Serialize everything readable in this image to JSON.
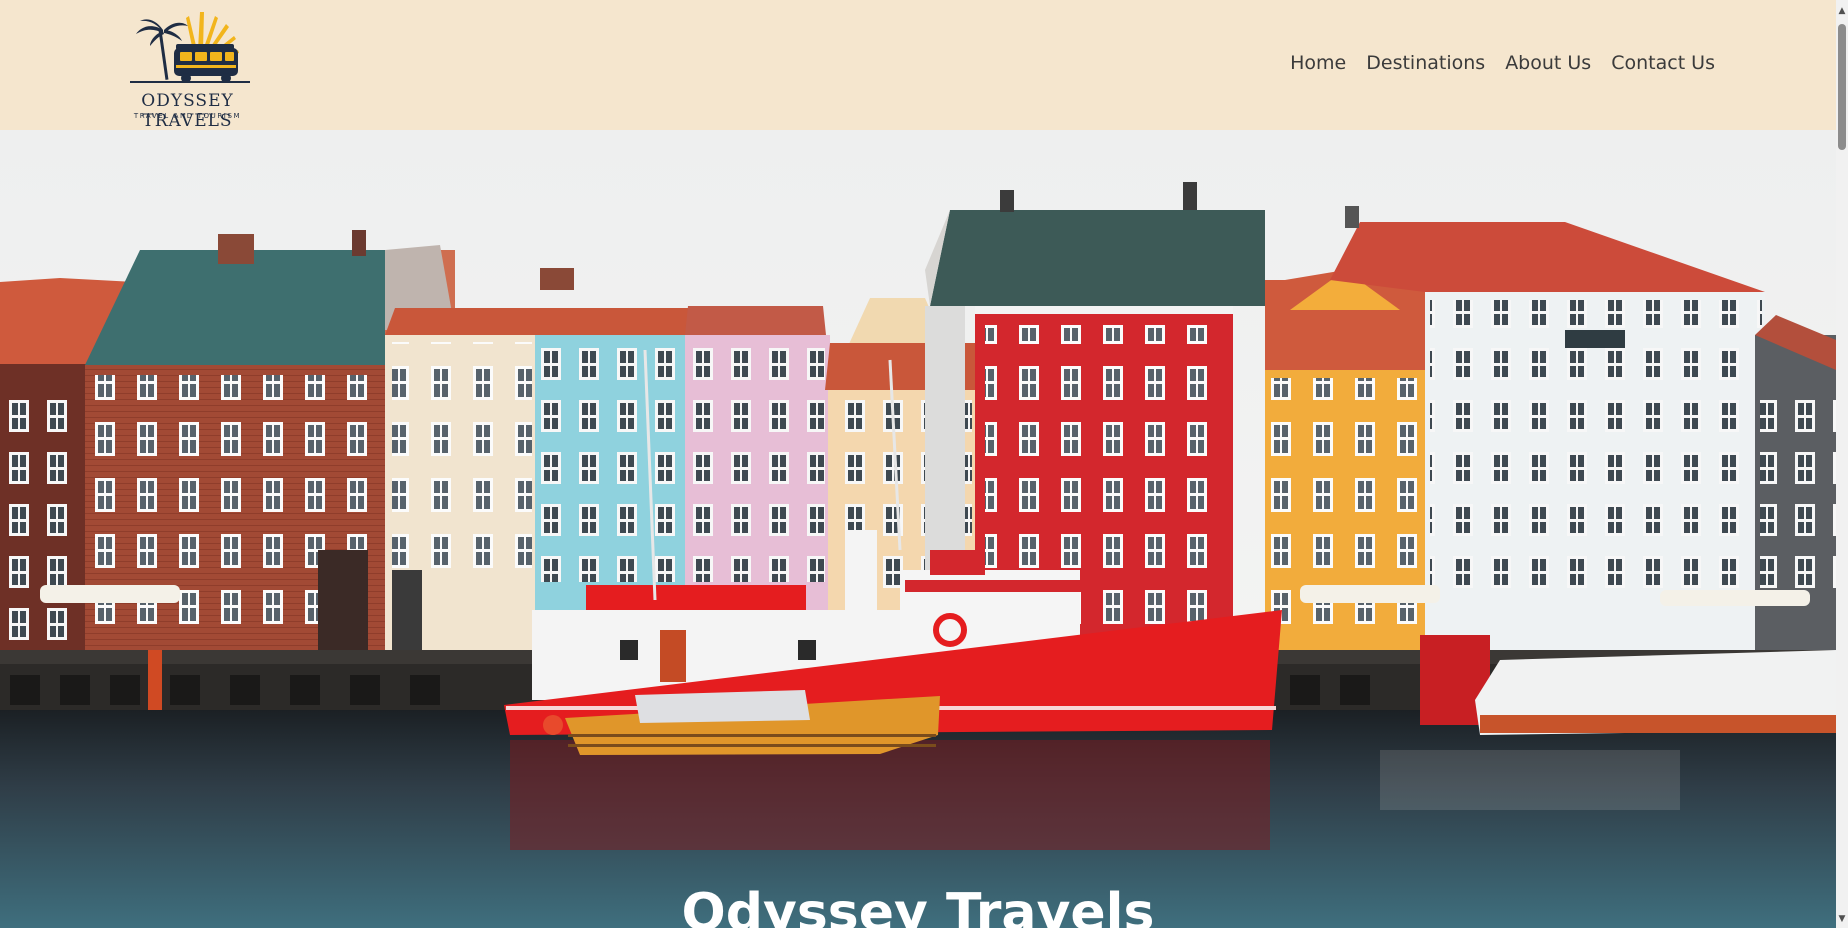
{
  "brand": {
    "name": "ODYSSEY TRAVELS",
    "tagline": "TRAVEL AND TOURISM"
  },
  "nav": {
    "items": [
      "Home",
      "Destinations",
      "About Us",
      "Contact Us"
    ]
  },
  "hero": {
    "title": "Odyssey Travels"
  },
  "scrollbar": {
    "up": "▲",
    "down": "▼"
  },
  "colors": {
    "header_bg": "#f5e6ce",
    "navy": "#1f2d44",
    "boat_red": "#e51d1f"
  }
}
